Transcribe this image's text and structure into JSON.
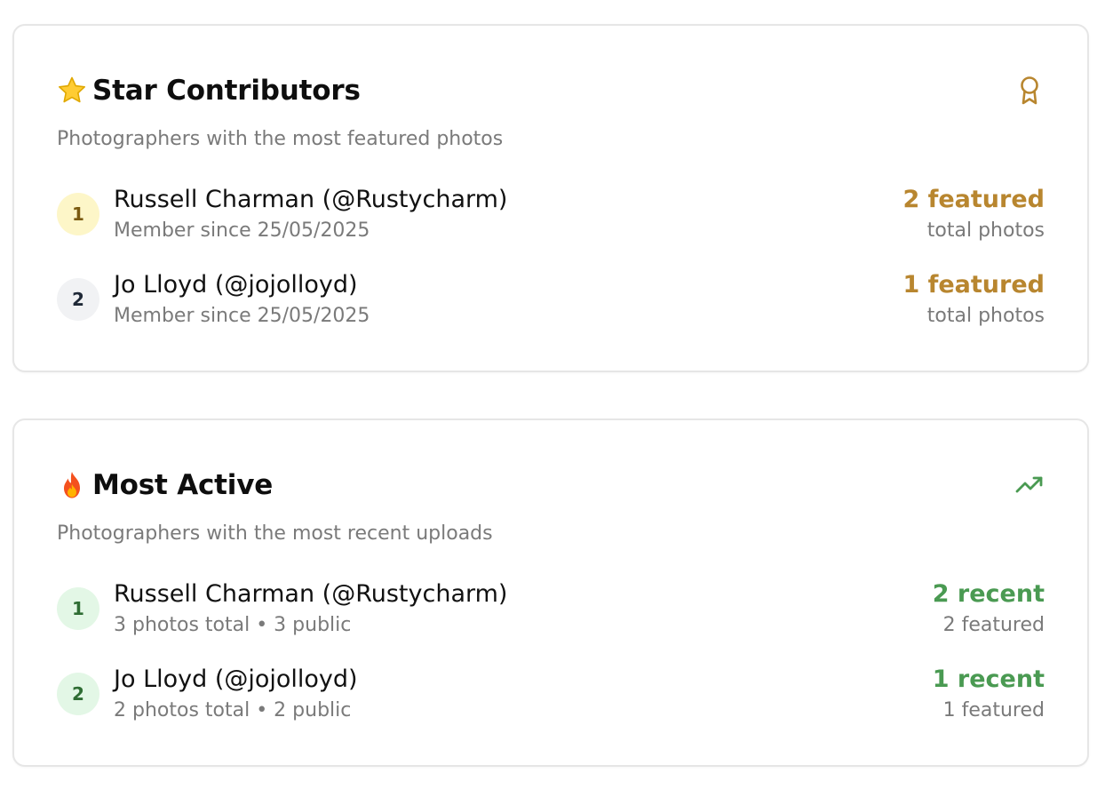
{
  "star_contributors": {
    "title": "Star Contributors",
    "title_icon": "star-emoji",
    "header_icon": "award-ribbon-icon",
    "subtitle": "Photographers with the most featured photos",
    "accent_color": "#b8862f",
    "rows": [
      {
        "rank": "1",
        "name": "Russell Charman (@Rustycharm)",
        "meta": "Member since 25/05/2025",
        "stat": "2 featured",
        "stat_sub": "total photos"
      },
      {
        "rank": "2",
        "name": "Jo Lloyd (@jojolloyd)",
        "meta": "Member since 25/05/2025",
        "stat": "1 featured",
        "stat_sub": "total photos"
      }
    ]
  },
  "most_active": {
    "title": "Most Active",
    "title_icon": "fire-emoji",
    "header_icon": "trending-up-icon",
    "subtitle": "Photographers with the most recent uploads",
    "accent_color": "#4a9a52",
    "rows": [
      {
        "rank": "1",
        "name": "Russell Charman (@Rustycharm)",
        "meta": "3 photos total • 3 public",
        "stat": "2 recent",
        "stat_sub": "2 featured"
      },
      {
        "rank": "2",
        "name": "Jo Lloyd (@jojolloyd)",
        "meta": "2 photos total • 2 public",
        "stat": "1 recent",
        "stat_sub": "1 featured"
      }
    ]
  }
}
